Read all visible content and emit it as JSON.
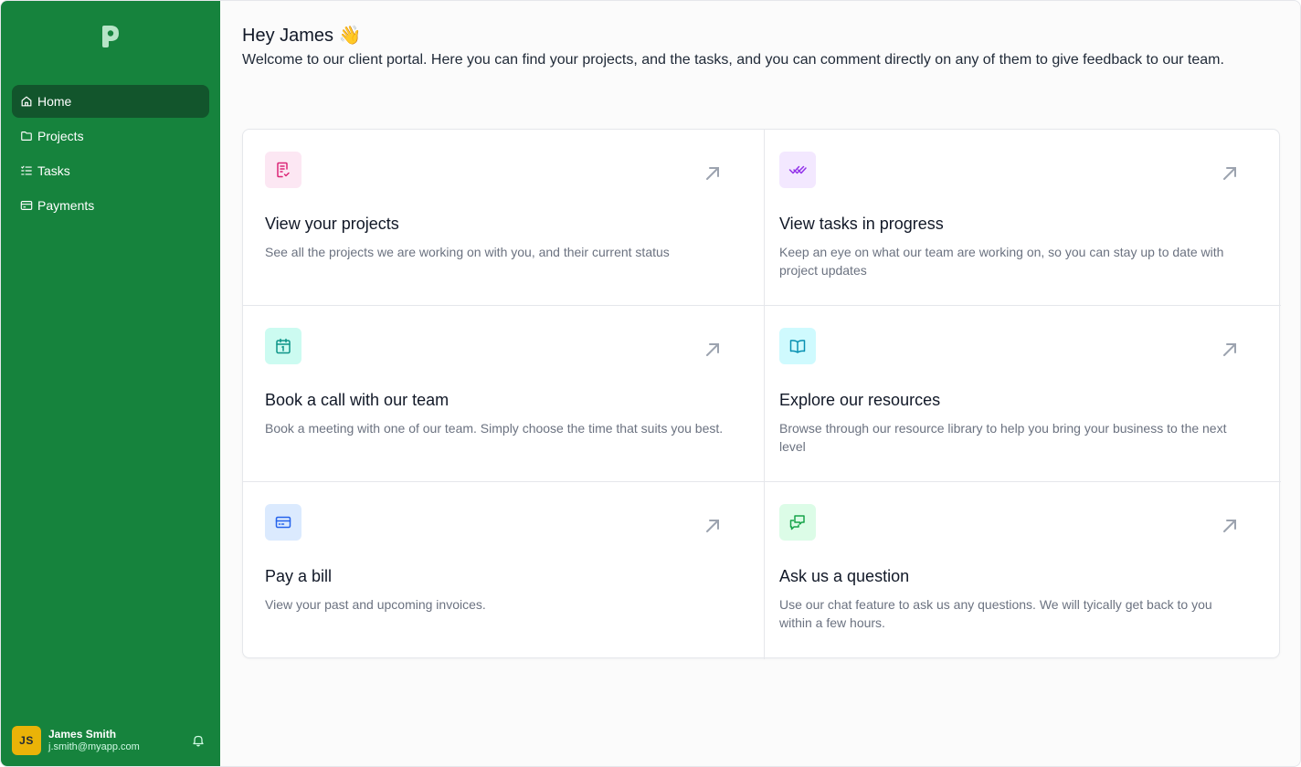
{
  "sidebar": {
    "logo_icon": "p-logo-icon",
    "items": [
      {
        "label": "Home",
        "icon": "home-icon",
        "active": true
      },
      {
        "label": "Projects",
        "icon": "folder-icon"
      },
      {
        "label": "Tasks",
        "icon": "list-checks-icon"
      },
      {
        "label": "Payments",
        "icon": "credit-card-icon"
      }
    ],
    "user": {
      "initials": "JS",
      "name": "James Smith",
      "email": "j.smith@myapp.com"
    }
  },
  "main": {
    "greeting": "Hey James 👋",
    "welcome": "Welcome to our client portal. Here you can find your projects, and the tasks, and you can comment directly on any of them to give feedback to our team.",
    "cards": [
      {
        "title": "View your projects",
        "desc": "See all the projects we are working on with you, and their current status",
        "icon": "document-check-icon",
        "icon_bg": "#fce7f3",
        "icon_color": "#db2777"
      },
      {
        "title": "View tasks in progress",
        "desc": "Keep an eye on what our team are working on, so you can stay up to date with project updates",
        "icon": "double-check-icon",
        "icon_bg": "#f3e8ff",
        "icon_color": "#9333ea"
      },
      {
        "title": "Book a call with our team",
        "desc": "Book a meeting with one of our team. Simply choose the time that suits you best.",
        "icon": "calendar-icon",
        "icon_bg": "#ccfbf1",
        "icon_color": "#0d9488"
      },
      {
        "title": "Explore our resources",
        "desc": "Browse through our resource library to help you bring your business to the next level",
        "icon": "book-open-icon",
        "icon_bg": "#cffafe",
        "icon_color": "#0891b2"
      },
      {
        "title": "Pay a bill",
        "desc": "View your past and upcoming invoices.",
        "icon": "credit-card-icon",
        "icon_bg": "#dbeafe",
        "icon_color": "#2563eb"
      },
      {
        "title": "Ask us a question",
        "desc": "Use our chat feature to ask us any questions. We will tyically get back to you within a few hours.",
        "icon": "chat-bubbles-icon",
        "icon_bg": "#dcfce7",
        "icon_color": "#16a34a"
      }
    ]
  },
  "colors": {
    "sidebar_bg": "#16833d",
    "active_item_bg": "#12552c",
    "avatar_bg": "#eab308"
  }
}
